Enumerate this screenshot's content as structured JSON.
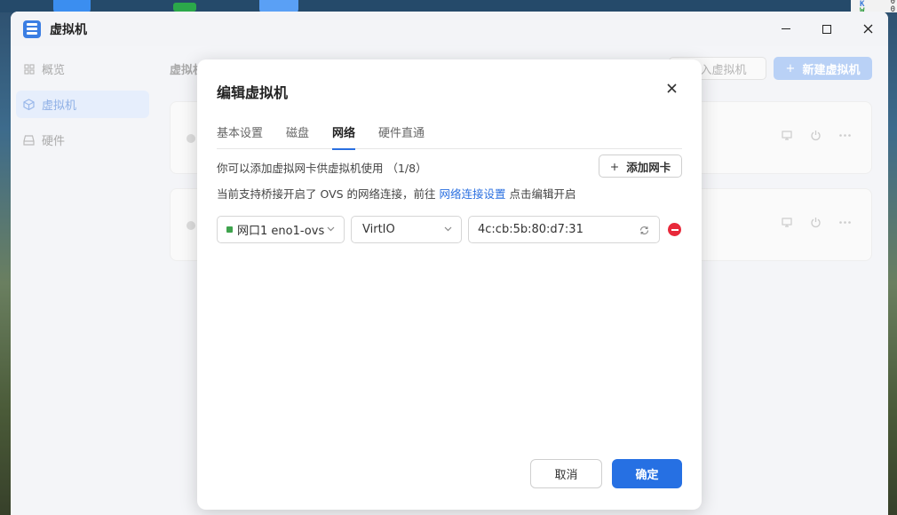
{
  "app": {
    "title": "虚拟机"
  },
  "sidebar": {
    "items": [
      {
        "label": "概览",
        "icon": "grid-icon",
        "active": false
      },
      {
        "label": "虚拟机",
        "icon": "cube-icon",
        "active": true
      },
      {
        "label": "硬件",
        "icon": "drive-icon",
        "active": false
      }
    ]
  },
  "content": {
    "title": "虚拟机",
    "import_label": "导入虚拟机",
    "new_label": "新建虚拟机"
  },
  "modal": {
    "title": "编辑虚拟机",
    "tabs": [
      {
        "label": "基本设置",
        "active": false
      },
      {
        "label": "磁盘",
        "active": false
      },
      {
        "label": "网络",
        "active": true
      },
      {
        "label": "硬件直通",
        "active": false
      }
    ],
    "info_text": "你可以添加虚拟网卡供虚拟机使用 （1/8）",
    "info2_prefix": "当前支持桥接开启了 OVS 的网络连接，前往",
    "info2_link": "网络连接设置",
    "info2_suffix": "点击编辑开启",
    "add_nic_label": "添加网卡",
    "nic": {
      "network": "网口1 eno1-ovs",
      "network_status_color": "#3fa34d",
      "model": "VirtIO",
      "mac": "4c:cb:5b:80:d7:31"
    },
    "cancel_label": "取消",
    "ok_label": "确定"
  },
  "colors": {
    "accent": "#2670e3",
    "danger": "#e8293a"
  }
}
